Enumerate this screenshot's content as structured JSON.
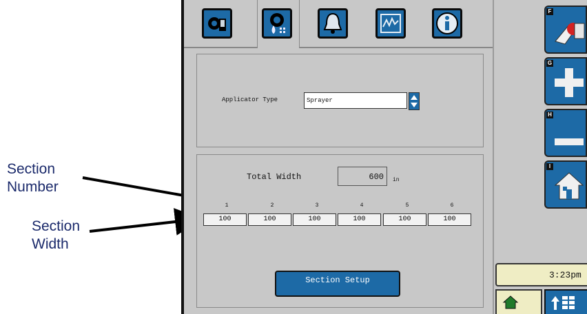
{
  "annotations": {
    "section_number": "Section\nNumber",
    "section_width": "Section\nWidth"
  },
  "tabs": [
    {
      "icon": "settings-gear-icon"
    },
    {
      "icon": "sprayer-settings-icon"
    },
    {
      "icon": "alarm-bell-icon"
    },
    {
      "icon": "graph-monitor-icon"
    },
    {
      "icon": "info-icon"
    }
  ],
  "applicator": {
    "label": "Applicator Type",
    "value": "Sprayer"
  },
  "width": {
    "label": "Total Width",
    "value": "600",
    "unit": "in"
  },
  "sections": [
    {
      "number": "1",
      "width": "100"
    },
    {
      "number": "2",
      "width": "100"
    },
    {
      "number": "3",
      "width": "100"
    },
    {
      "number": "4",
      "width": "100"
    },
    {
      "number": "5",
      "width": "100"
    },
    {
      "number": "6",
      "width": "100"
    }
  ],
  "section_setup_label": "Section Setup",
  "softkeys": [
    {
      "key": "F",
      "icon": "toggle-switch-icon"
    },
    {
      "key": "G",
      "icon": "plus-icon"
    },
    {
      "key": "H",
      "icon": "minus-icon"
    },
    {
      "key": "I",
      "icon": "home-icon"
    }
  ],
  "clock": "3:23pm",
  "colors": {
    "accent_blue": "#1d6aa6",
    "panel_gray": "#c8c8c8",
    "annotation_text": "#1b2a6b",
    "clock_bg": "#efedc4"
  }
}
